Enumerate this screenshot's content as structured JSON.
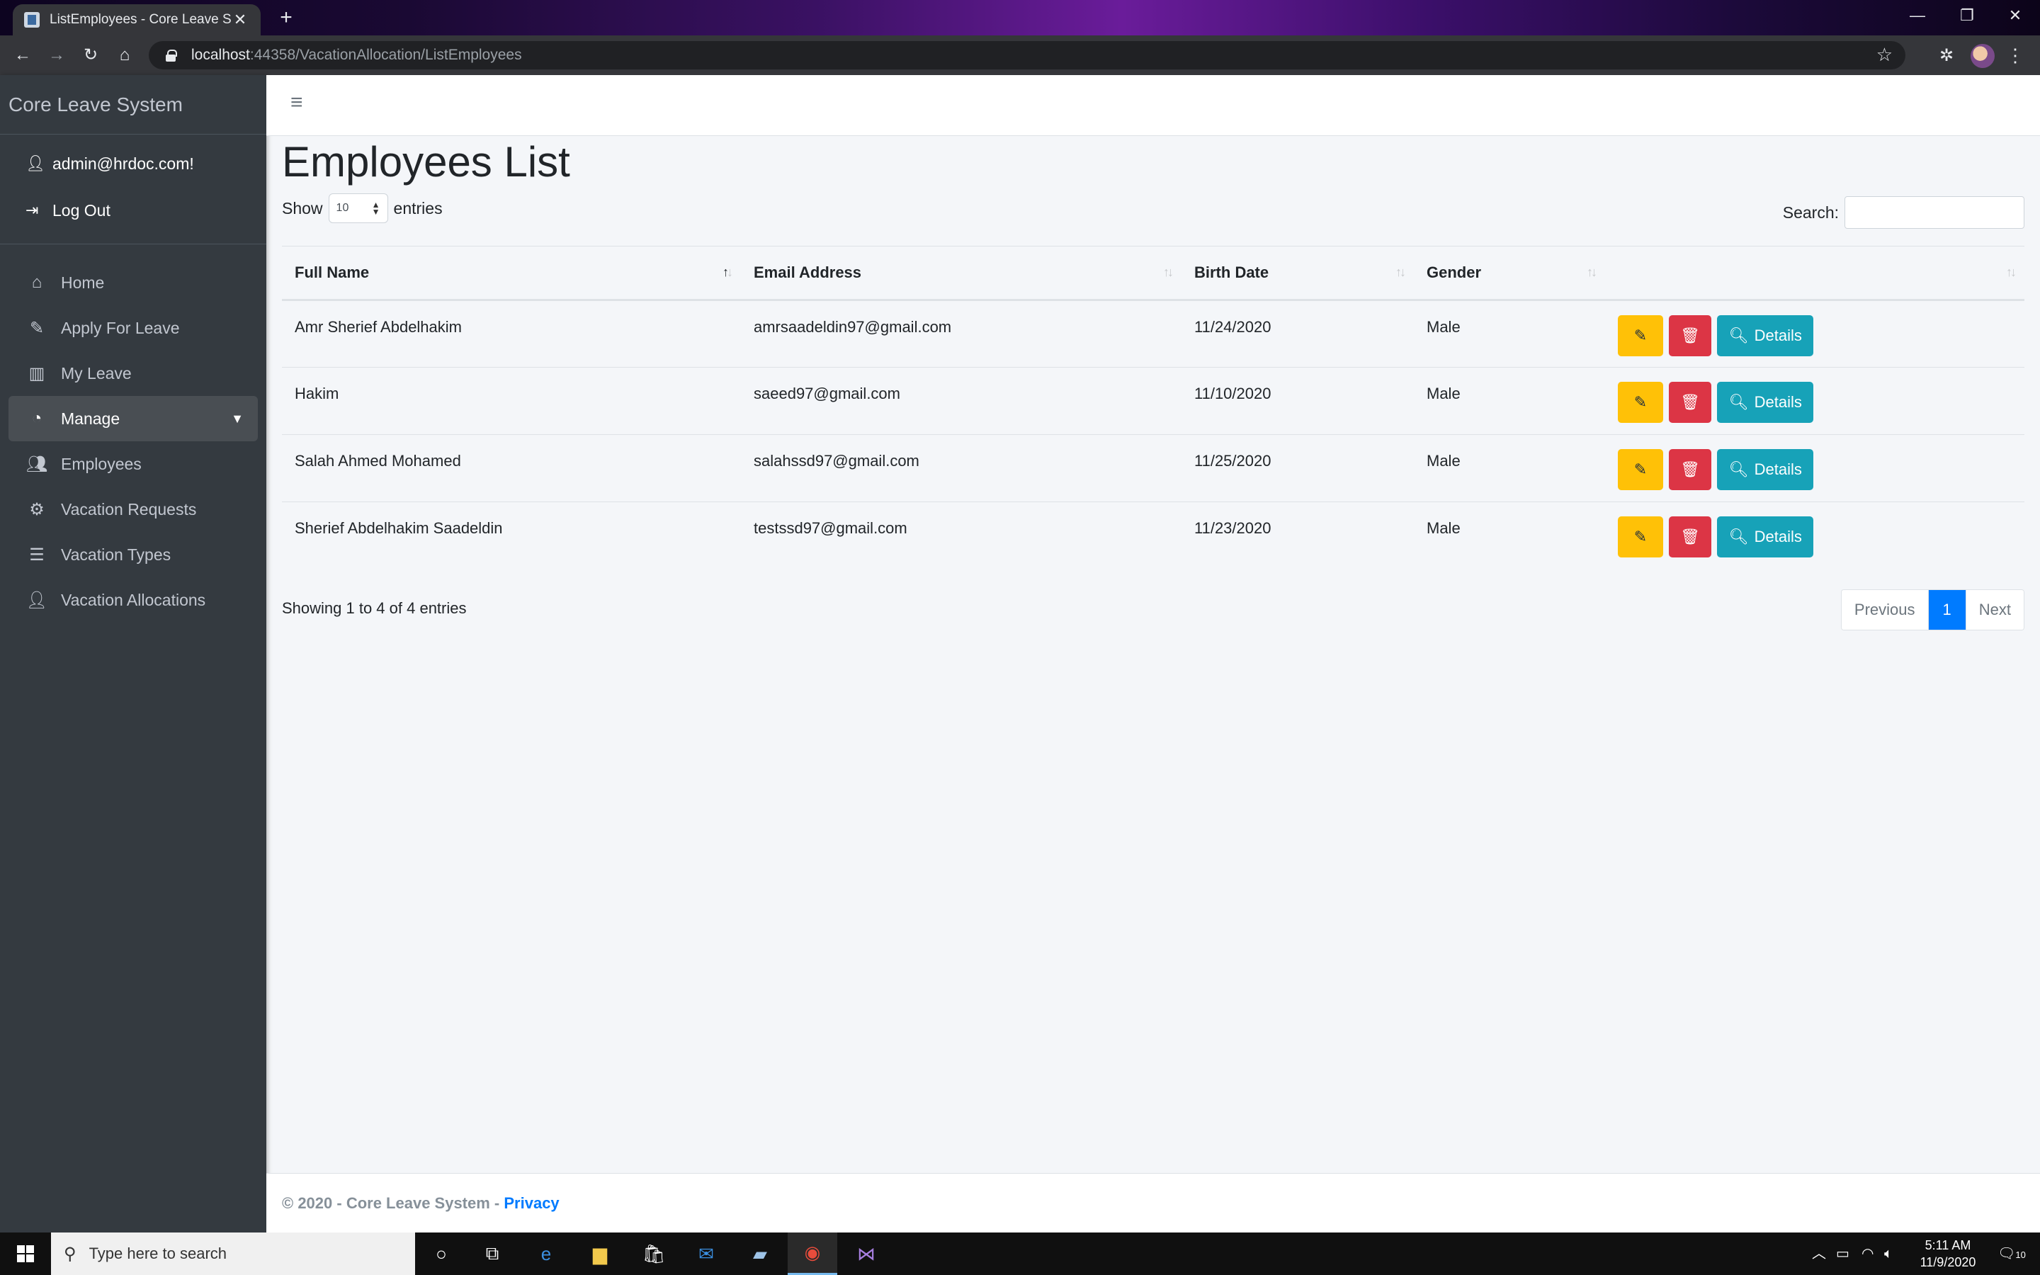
{
  "browser": {
    "tab_title": "ListEmployees - Core Leave Syste",
    "tab_close": "✕",
    "new_tab": "+",
    "url_host": "localhost",
    "url_rest": ":44358/VacationAllocation/ListEmployees",
    "window_controls": {
      "minimize": "—",
      "restore": "❐",
      "close": "✕"
    },
    "nav": {
      "back": "←",
      "forward": "→",
      "reload": "↻",
      "home": "⌂"
    }
  },
  "sidebar": {
    "brand": "Core Leave System",
    "user": {
      "email": "admin@hrdoc.com!",
      "logout": "Log Out"
    },
    "items": [
      {
        "label": "Home",
        "icon": "home-icon"
      },
      {
        "label": "Apply For Leave",
        "icon": "pencil-icon"
      },
      {
        "label": "My Leave",
        "icon": "book-icon"
      },
      {
        "label": "Manage",
        "icon": "dashboard-icon",
        "active": true
      },
      {
        "label": "Employees",
        "icon": "users-icon"
      },
      {
        "label": "Vacation Requests",
        "icon": "cogs-icon"
      },
      {
        "label": "Vacation Types",
        "icon": "list-icon"
      },
      {
        "label": "Vacation Allocations",
        "icon": "user-plus-icon"
      }
    ]
  },
  "main": {
    "title": "Employees List",
    "show_label": "Show",
    "page_length": "10",
    "entries_label": "entries",
    "search_label": "Search:",
    "search_value": "",
    "columns": [
      "Full Name",
      "Email Address",
      "Birth Date",
      "Gender",
      ""
    ],
    "rows": [
      {
        "name": "Amr Sherief Abdelhakim",
        "email": "amrsaadeldin97@gmail.com",
        "birth": "11/24/2020",
        "gender": "Male"
      },
      {
        "name": "Hakim",
        "email": "saeed97@gmail.com",
        "birth": "11/10/2020",
        "gender": "Male"
      },
      {
        "name": "Salah Ahmed Mohamed",
        "email": "salahssd97@gmail.com",
        "birth": "11/25/2020",
        "gender": "Male"
      },
      {
        "name": "Sherief Abdelhakim Saadeldin",
        "email": "testssd97@gmail.com",
        "birth": "11/23/2020",
        "gender": "Male"
      }
    ],
    "details_label": "Details",
    "info": "Showing 1 to 4 of 4 entries",
    "pagination": {
      "previous": "Previous",
      "current": "1",
      "next": "Next"
    }
  },
  "footer": {
    "text": "© 2020 - Core Leave System - ",
    "link": "Privacy"
  },
  "taskbar": {
    "search_placeholder": "Type here to search",
    "time": "5:11 AM",
    "date": "11/9/2020",
    "notifications": "10"
  },
  "colors": {
    "sidebar_bg": "#343a40",
    "edit_button": "#ffc107",
    "delete_button": "#dc3545",
    "details_button": "#17a2b8",
    "primary": "#007bff"
  }
}
